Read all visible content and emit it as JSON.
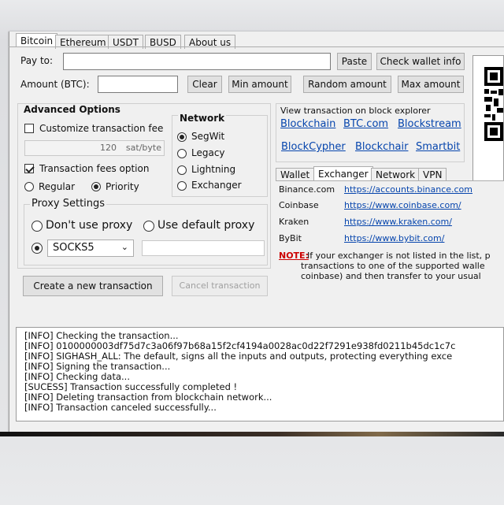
{
  "tabs": [
    "Bitcoin",
    "Ethereum",
    "USDT",
    "BUSD",
    "About us"
  ],
  "pay_to": {
    "label": "Pay to:",
    "value": ""
  },
  "buttons": {
    "paste": "Paste",
    "check_wallet": "Check wallet info",
    "clear": "Clear",
    "min_amount": "Min amount",
    "random_amount": "Random amount",
    "max_amount": "Max amount",
    "create": "Create a new transaction",
    "cancel": "Cancel transaction"
  },
  "amount": {
    "label": "Amount (BTC):",
    "value": ""
  },
  "advanced": {
    "title": "Advanced Options",
    "customize_fee": "Customize transaction fee",
    "fee_value": "120",
    "fee_unit": "sat/byte",
    "fees_option": "Transaction fees option",
    "regular": "Regular",
    "priority": "Priority"
  },
  "network": {
    "title": "Network",
    "segwit": "SegWit",
    "legacy": "Legacy",
    "lightning": "Lightning",
    "exchanger": "Exchanger"
  },
  "explorer": {
    "title": "View transaction on block explorer",
    "links": [
      "Blockchain",
      "BTC.com",
      "Blockstream",
      "BlockCypher",
      "Blockchair",
      "Smartbit"
    ]
  },
  "proxy": {
    "title": "Proxy Settings",
    "dont_use": "Don't use proxy",
    "use_default": "Use default proxy",
    "type": "SOCKS5",
    "address": ""
  },
  "subtabs": [
    "Wallet",
    "Exchanger",
    "Network",
    "VPN"
  ],
  "exchanges": [
    {
      "name": "Binance.com",
      "url": "https://accounts.binance.com"
    },
    {
      "name": "Coinbase",
      "url": "https://www.coinbase.com/"
    },
    {
      "name": "Kraken",
      "url": "https://www.kraken.com/"
    },
    {
      "name": "ByBit",
      "url": "https://www.bybit.com/"
    }
  ],
  "note": {
    "label": "NOTE:",
    "line1": " If your exchanger is not listed in the list, p",
    "line2": "transactions to one of the supported walle",
    "line3": "coinbase) and then transfer to your usual"
  },
  "log": [
    "[INFO]   Checking the transaction...",
    "[INFO]   0100000003df75d7c3a06f97b68a15f2cf4194a0028ac0d22f7291e938fd0211b45dc1c7c",
    "[INFO]   SIGHASH_ALL: The default, signs all the inputs and outputs, protecting everything exce",
    "[INFO]   Signing the transaction...",
    "[INFO]   Checking data...",
    "[SUCESS]  Transaction successfully completed !",
    "[INFO]   Deleting transaction from blockchain network...",
    "[INFO]   Transaction canceled successfully..."
  ],
  "colors": {
    "link": "#0645ad",
    "note": "#cc0000",
    "window": "#f0f0f0"
  }
}
